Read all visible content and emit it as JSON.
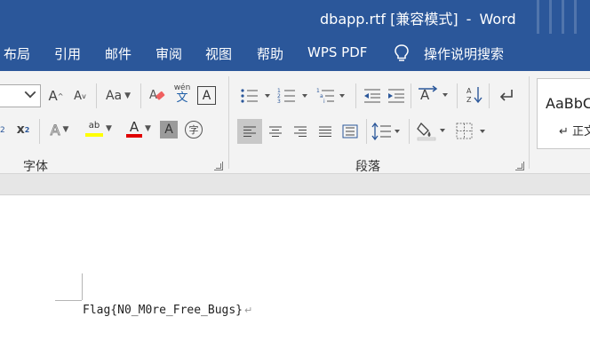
{
  "window": {
    "doc_name": "dbapp.rtf [兼容模式]",
    "separator": "-",
    "app_name": "Word"
  },
  "menu": {
    "items": [
      "布局",
      "引用",
      "邮件",
      "审阅",
      "视图",
      "帮助",
      "WPS PDF"
    ],
    "tell_me": "操作说明搜索"
  },
  "ribbon": {
    "font_group": {
      "label": "字体",
      "grow_font": "A",
      "shrink_font": "A",
      "change_case": "Aa",
      "phonetic_top": "wén",
      "phonetic_bottom": "文",
      "char_border": "A",
      "superscript": "x",
      "text_effects": "A",
      "highlight": "ab",
      "font_color": "A",
      "char_shading": "A",
      "enclose_char": "字",
      "highlight_color": "#ffff00",
      "font_color_value": "#e00000"
    },
    "paragraph_group": {
      "label": "段落"
    },
    "styles": {
      "sample": "AaBbC",
      "name": "↵ 正文"
    }
  },
  "document": {
    "text": "Flag{N0_M0re_Free_Bugs}",
    "para_mark": "↵"
  },
  "colors": {
    "brand_blue": "#2b579a",
    "ribbon_bg": "#f3f3f3"
  }
}
